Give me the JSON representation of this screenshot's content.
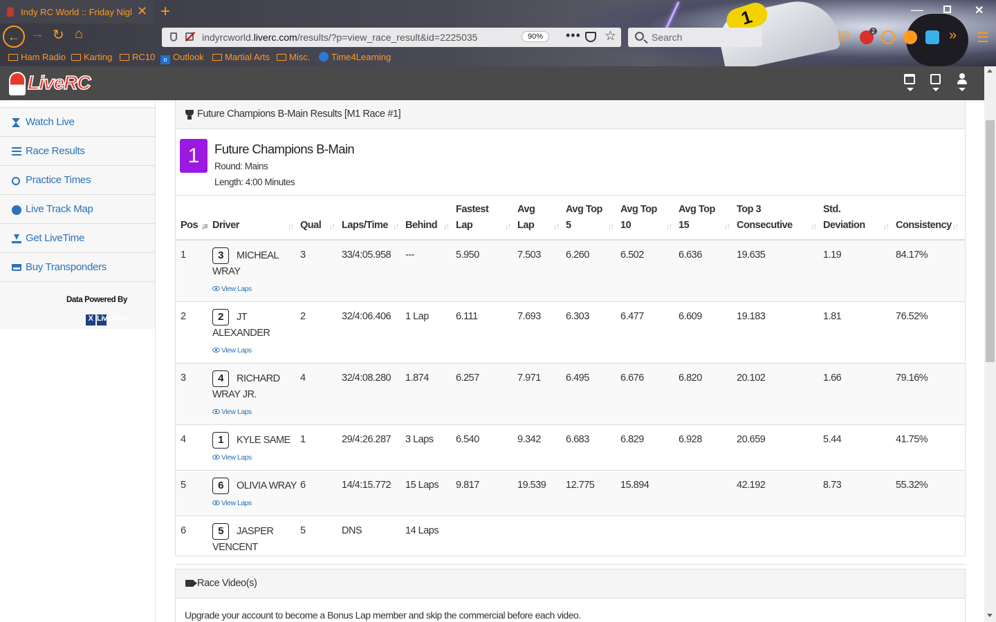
{
  "browser": {
    "tab_title": "Indy RC World :: Friday Night Dirt",
    "url_prefix": "indyrcworld.",
    "url_domain": "liverc.com",
    "url_path": "/results/?p=view_race_result&id=2225035",
    "zoom": "90%",
    "search_placeholder": "Search",
    "adblock_count": "2",
    "bookmarks": [
      "Ham Radio",
      "Karting",
      "RC10",
      "Outlook",
      "Martial Arts",
      "Misc.",
      "Time4Learning"
    ]
  },
  "site": {
    "logo": "LiveRC"
  },
  "sidebar": {
    "items": [
      {
        "label": "Watch Live",
        "icon": "hourglass-icon"
      },
      {
        "label": "Race Results",
        "icon": "list-icon"
      },
      {
        "label": "Practice Times",
        "icon": "clock-icon"
      },
      {
        "label": "Live Track Map",
        "icon": "globe-icon"
      },
      {
        "label": "Get LiveTime",
        "icon": "download-icon"
      },
      {
        "label": "Buy Transponders",
        "icon": "cart-icon"
      }
    ],
    "powered_by": "Data Powered By",
    "livetime_logo": "LiveTime"
  },
  "results": {
    "panel_title": "Future Champions B-Main Results [M1 Race #1]",
    "race_number": "1",
    "race_name": "Future Champions B-Main",
    "round": "Round: Mains",
    "length": "Length: 4:00 Minutes",
    "view_laps_label": "View Laps",
    "columns": [
      "Pos",
      "Driver",
      "Qual",
      "Laps/Time",
      "Behind",
      "Fastest Lap",
      "Avg Lap",
      "Avg Top 5",
      "Avg Top 10",
      "Avg Top 15",
      "Top 3 Consecutive",
      "Std. Deviation",
      "Consistency"
    ],
    "header_lines": [
      [
        "Pos"
      ],
      [
        "Driver"
      ],
      [
        "Qual"
      ],
      [
        "Laps/Time"
      ],
      [
        "Behind"
      ],
      [
        "Fastest",
        "Lap"
      ],
      [
        "Avg",
        "Lap"
      ],
      [
        "Avg Top",
        "5"
      ],
      [
        "Avg Top",
        "10"
      ],
      [
        "Avg Top",
        "15"
      ],
      [
        "Top 3",
        "Consecutive"
      ],
      [
        "Std.",
        "Deviation"
      ],
      [
        "Consistency"
      ]
    ],
    "rows": [
      {
        "pos": "1",
        "car": "3",
        "driver": "MICHEAL WRAY",
        "qual": "3",
        "laps_time": "33/4:05.958",
        "behind": "---",
        "fastest": "5.950",
        "avg_lap": "7.503",
        "avg_top5": "6.260",
        "avg_top10": "6.502",
        "avg_top15": "6.636",
        "top3_consec": "19.635",
        "std_dev": "1.19",
        "consistency": "84.17%",
        "view_laps": true
      },
      {
        "pos": "2",
        "car": "2",
        "driver": "JT ALEXANDER",
        "qual": "2",
        "laps_time": "32/4:06.406",
        "behind": "1 Lap",
        "fastest": "6.111",
        "avg_lap": "7.693",
        "avg_top5": "6.303",
        "avg_top10": "6.477",
        "avg_top15": "6.609",
        "top3_consec": "19.183",
        "std_dev": "1.81",
        "consistency": "76.52%",
        "view_laps": true
      },
      {
        "pos": "3",
        "car": "4",
        "driver": "RICHARD WRAY JR.",
        "qual": "4",
        "laps_time": "32/4:08.280",
        "behind": "1.874",
        "fastest": "6.257",
        "avg_lap": "7.971",
        "avg_top5": "6.495",
        "avg_top10": "6.676",
        "avg_top15": "6.820",
        "top3_consec": "20.102",
        "std_dev": "1.66",
        "consistency": "79.16%",
        "view_laps": true
      },
      {
        "pos": "4",
        "car": "1",
        "driver": "KYLE SAME",
        "qual": "1",
        "laps_time": "29/4:26.287",
        "behind": "3 Laps",
        "fastest": "6.540",
        "avg_lap": "9.342",
        "avg_top5": "6.683",
        "avg_top10": "6.829",
        "avg_top15": "6.928",
        "top3_consec": "20.659",
        "std_dev": "5.44",
        "consistency": "41.75%",
        "view_laps": true
      },
      {
        "pos": "5",
        "car": "6",
        "driver": "OLIVIA WRAY",
        "qual": "6",
        "laps_time": "14/4:15.772",
        "behind": "15 Laps",
        "fastest": "9.817",
        "avg_lap": "19.539",
        "avg_top5": "12.775",
        "avg_top10": "15.894",
        "avg_top15": "",
        "top3_consec": "42.192",
        "std_dev": "8.73",
        "consistency": "55.32%",
        "view_laps": true
      },
      {
        "pos": "6",
        "car": "5",
        "driver": "JASPER VENCENT",
        "qual": "5",
        "laps_time": "DNS",
        "behind": "14 Laps",
        "fastest": "",
        "avg_lap": "",
        "avg_top5": "",
        "avg_top10": "",
        "avg_top15": "",
        "top3_consec": "",
        "std_dev": "",
        "consistency": "",
        "view_laps": false
      }
    ]
  },
  "video": {
    "title": "Race Video(s)",
    "note": "Upgrade your account to become a Bonus Lap member and skip the commercial before each video."
  }
}
